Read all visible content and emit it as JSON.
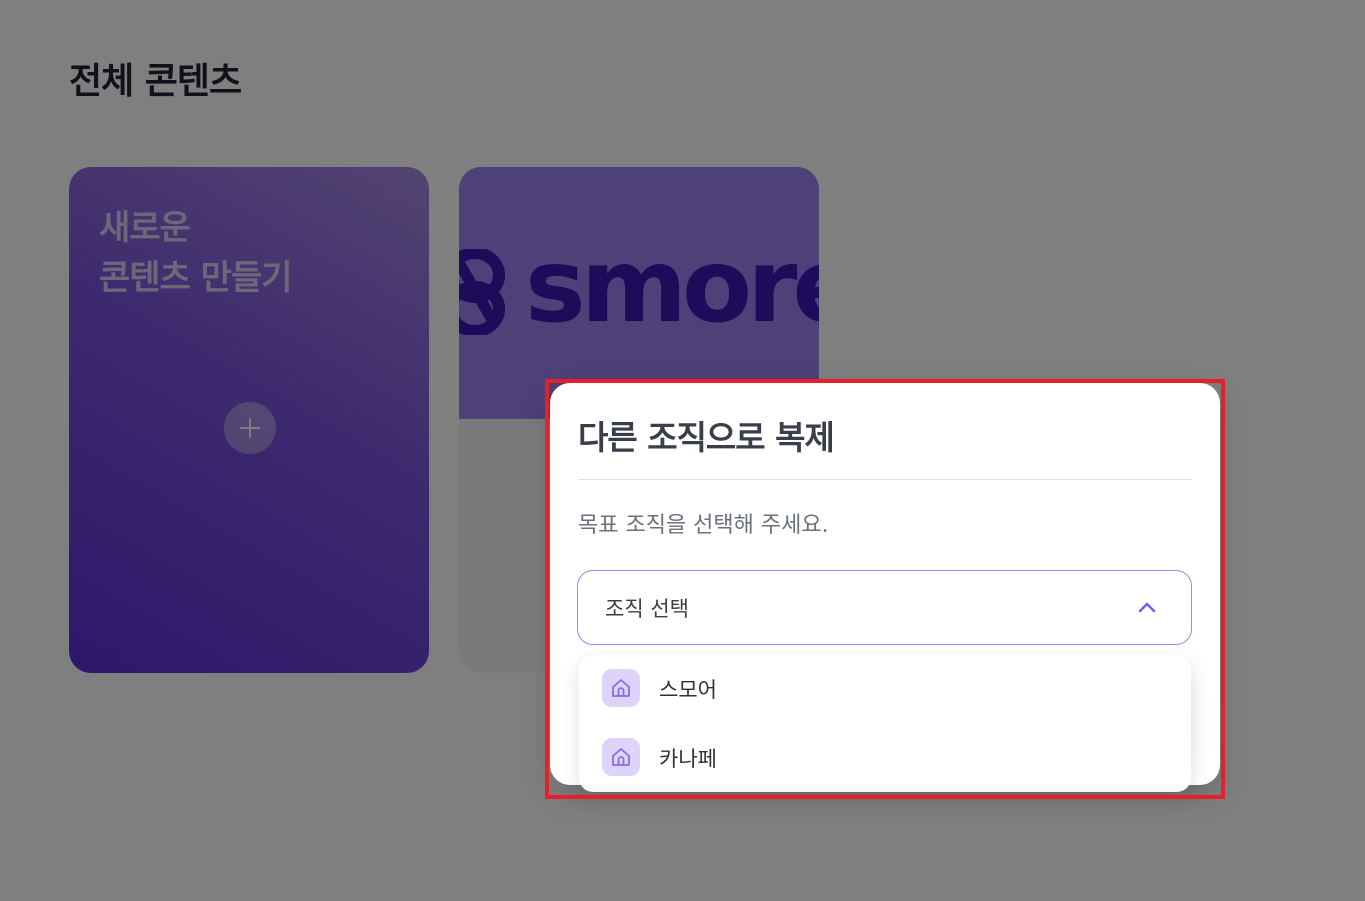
{
  "page": {
    "title": "전체 콘텐츠"
  },
  "cards": {
    "new_content": {
      "title": "새로운\n콘텐츠 만들기",
      "plus_icon": "plus-icon"
    },
    "smore": {
      "logo_text": "smore",
      "logo_icon": "smore-logo-icon"
    }
  },
  "modal": {
    "title": "다른 조직으로 복제",
    "description": "목표 조직을 선택해 주세요.",
    "select": {
      "value": "조직 선택",
      "icon": "chevron-up-icon"
    },
    "options": [
      {
        "label": "스모어",
        "icon": "home-icon"
      },
      {
        "label": "카나페",
        "icon": "home-icon"
      }
    ]
  },
  "colors": {
    "accent": "#7b5cf0",
    "highlight": "#e3202b",
    "brand_dark": "#3c18b5"
  }
}
